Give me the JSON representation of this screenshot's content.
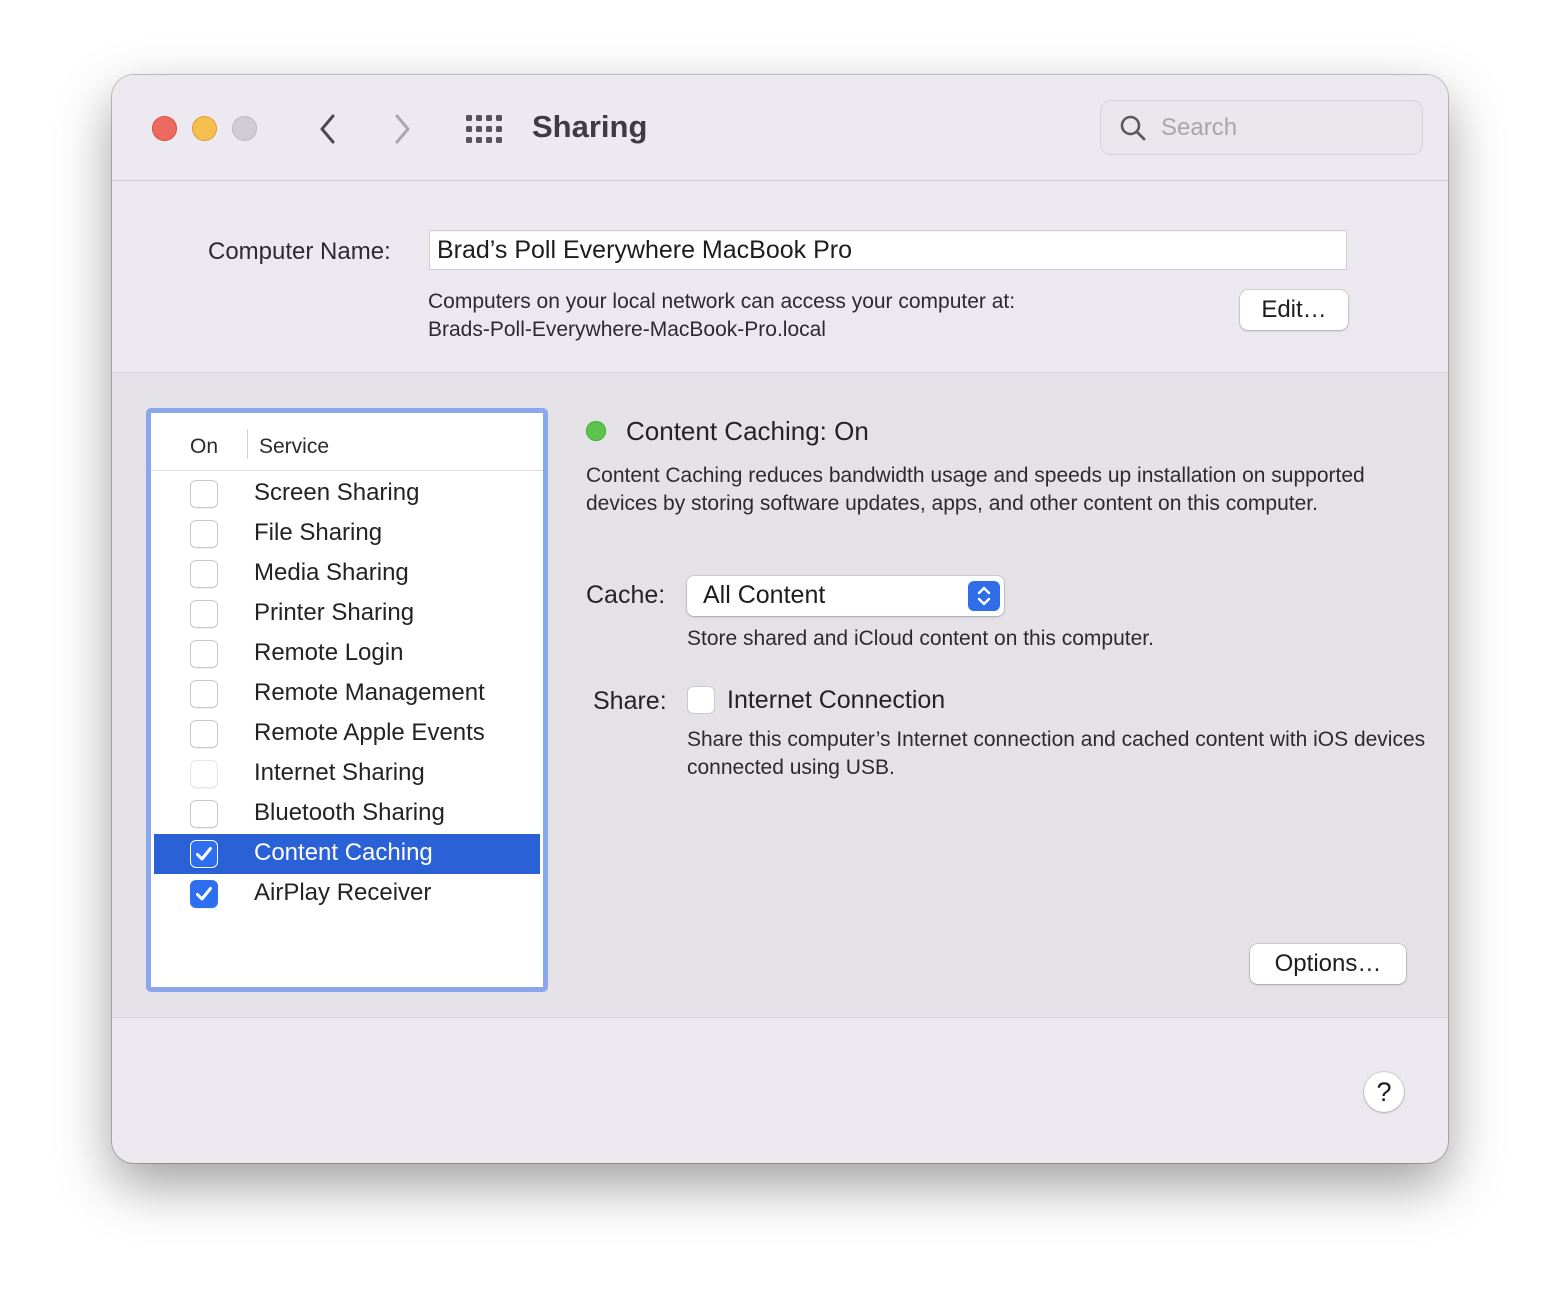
{
  "window": {
    "title": "Sharing",
    "search": {
      "placeholder": "Search",
      "value": ""
    }
  },
  "computer_name": {
    "label": "Computer Name:",
    "value": "Brad’s Poll Everywhere MacBook Pro",
    "info_line1": "Computers on your local network can access your computer at:",
    "info_line2": "Brads-Poll-Everywhere-MacBook-Pro.local",
    "edit_label": "Edit…"
  },
  "services": {
    "header_on": "On",
    "header_service": "Service",
    "items": [
      {
        "label": "Screen Sharing",
        "checked": false,
        "selected": false,
        "disabled": false
      },
      {
        "label": "File Sharing",
        "checked": false,
        "selected": false,
        "disabled": false
      },
      {
        "label": "Media Sharing",
        "checked": false,
        "selected": false,
        "disabled": false
      },
      {
        "label": "Printer Sharing",
        "checked": false,
        "selected": false,
        "disabled": false
      },
      {
        "label": "Remote Login",
        "checked": false,
        "selected": false,
        "disabled": false
      },
      {
        "label": "Remote Management",
        "checked": false,
        "selected": false,
        "disabled": false
      },
      {
        "label": "Remote Apple Events",
        "checked": false,
        "selected": false,
        "disabled": false
      },
      {
        "label": "Internet Sharing",
        "checked": false,
        "selected": false,
        "disabled": true
      },
      {
        "label": "Bluetooth Sharing",
        "checked": false,
        "selected": false,
        "disabled": false
      },
      {
        "label": "Content Caching",
        "checked": true,
        "selected": true,
        "disabled": false
      },
      {
        "label": "AirPlay Receiver",
        "checked": true,
        "selected": false,
        "disabled": false
      }
    ]
  },
  "detail": {
    "status": "Content Caching: On",
    "status_color": "#5ac44c",
    "description": "Content Caching reduces bandwidth usage and speeds up installation on supported devices by storing software updates, apps, and other content on this computer.",
    "cache_label": "Cache:",
    "cache_value": "All Content",
    "cache_note": "Store shared and iCloud content on this computer.",
    "share_label": "Share:",
    "share_option": "Internet Connection",
    "share_checked": false,
    "share_note": "Share this computer’s Internet connection and cached content with iOS devices connected using USB.",
    "options_label": "Options…"
  },
  "help": {
    "label": "?"
  },
  "colors": {
    "accent": "#2e6ff0",
    "selection": "#2b61d6",
    "list_focus_ring": "#8aa6ec"
  }
}
